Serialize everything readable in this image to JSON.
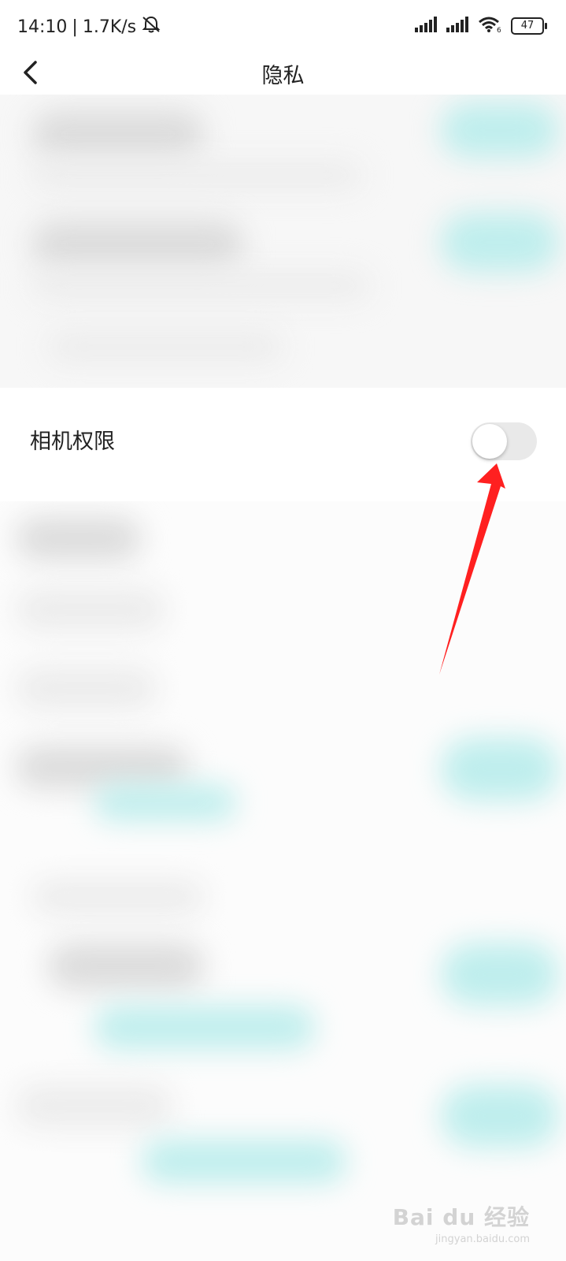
{
  "status_bar": {
    "time": "14:10",
    "net_speed": "1.7K/s",
    "battery_level": "47",
    "icons": [
      "mute-bell-icon",
      "signal-icon",
      "signal-icon",
      "wifi-icon",
      "battery-icon"
    ]
  },
  "nav": {
    "title": "隐私",
    "back_icon": "chevron-left-icon"
  },
  "camera_setting": {
    "label": "相机权限",
    "enabled": false
  },
  "annotation": {
    "color": "#ff2020"
  },
  "watermark": {
    "brand": "Bai du 经验",
    "url": "jingyan.baidu.com"
  },
  "colors": {
    "background": "#ffffff",
    "toggle_off_track": "#e9e9e9",
    "blur_accent": "#bfeeed"
  }
}
